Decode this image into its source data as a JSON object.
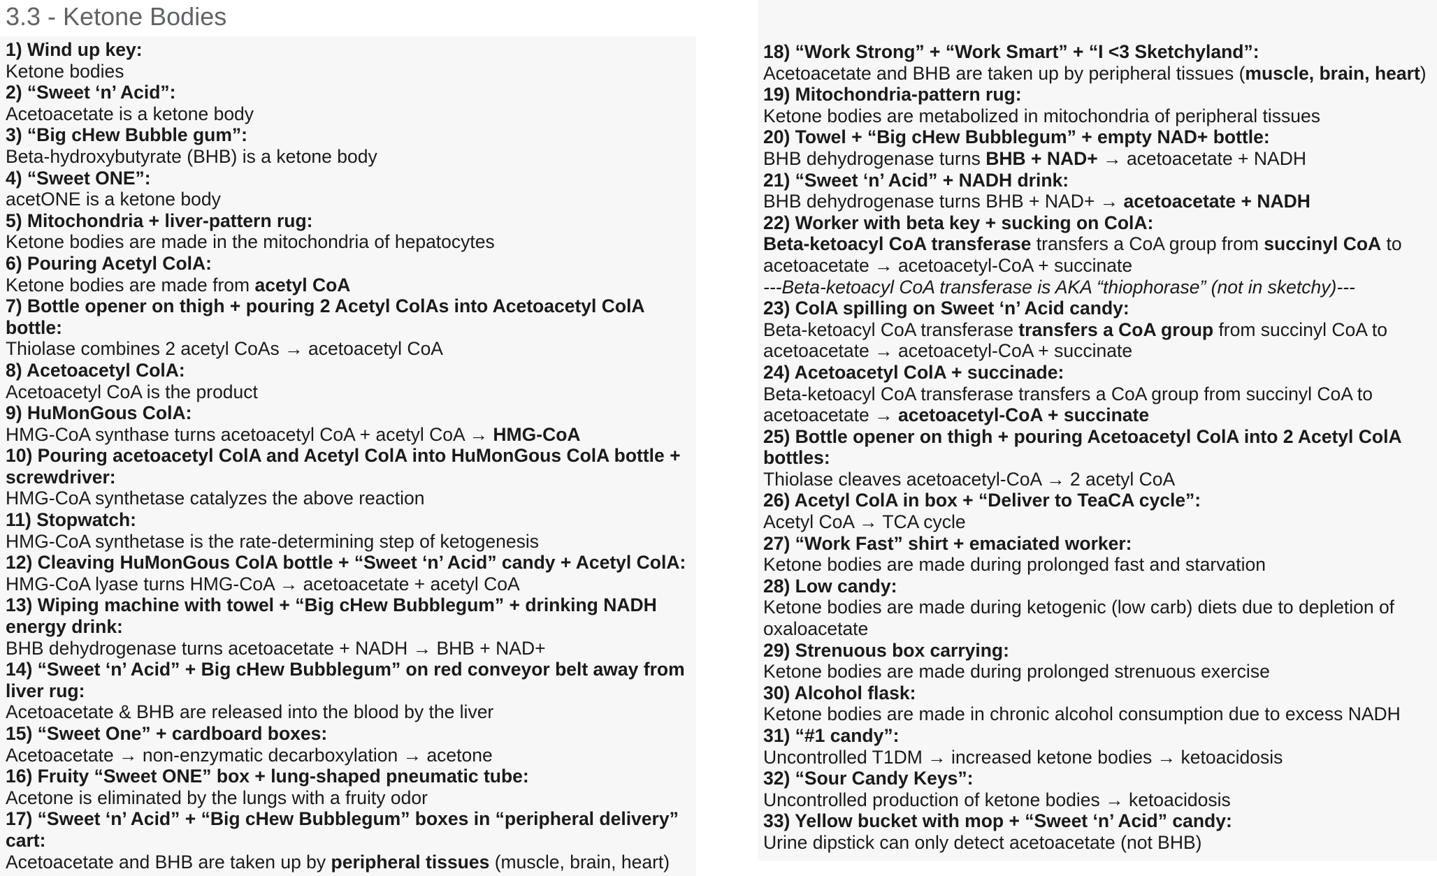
{
  "page": {
    "title": "3.3 - Ketone Bodies"
  },
  "left_column": [
    {
      "heading": "1) Wind up key:",
      "lines": [
        [
          {
            "t": "Ketone bodies"
          }
        ]
      ]
    },
    {
      "heading": "2) “Sweet ‘n’ Acid”:",
      "lines": [
        [
          {
            "t": "Acetoacetate is a ketone body"
          }
        ]
      ]
    },
    {
      "heading": "3) “Big cHew Bubble gum”:",
      "lines": [
        [
          {
            "t": "Beta-hydroxybutyrate (BHB) is a ketone body"
          }
        ]
      ]
    },
    {
      "heading": "4) “Sweet ONE”:",
      "lines": [
        [
          {
            "t": "acetONE is a ketone body"
          }
        ]
      ]
    },
    {
      "heading": "5) Mitochondria + liver-pattern rug:",
      "lines": [
        [
          {
            "t": "Ketone bodies are made in the mitochondria of hepatocytes"
          }
        ]
      ]
    },
    {
      "heading": "6) Pouring Acetyl ColA:",
      "lines": [
        [
          {
            "t": "Ketone bodies are made from "
          },
          {
            "t": "acetyl CoA",
            "b": true
          }
        ]
      ]
    },
    {
      "heading": "7) Bottle opener on thigh + pouring 2 Acetyl ColAs into Acetoacetyl ColA bottle:",
      "lines": [
        [
          {
            "t": "Thiolase combines 2 acetyl CoAs → acetoacetyl CoA"
          }
        ]
      ]
    },
    {
      "heading": "8) Acetoacetyl ColA:",
      "lines": [
        [
          {
            "t": "Acetoacetyl CoA is the product"
          }
        ]
      ]
    },
    {
      "heading": "9) HuMonGous ColA:",
      "lines": [
        [
          {
            "t": "HMG-CoA synthase turns acetoacetyl CoA + acetyl CoA → "
          },
          {
            "t": "HMG-CoA",
            "b": true
          }
        ]
      ]
    },
    {
      "heading": "10) Pouring acetoacetyl ColA and Acetyl ColA into HuMonGous ColA bottle + screwdriver:",
      "lines": [
        [
          {
            "t": "HMG-CoA synthetase catalyzes the above reaction"
          }
        ]
      ]
    },
    {
      "heading": "11) Stopwatch:",
      "lines": [
        [
          {
            "t": "HMG-CoA synthetase is the rate-determining step of ketogenesis"
          }
        ]
      ]
    },
    {
      "heading": "12) Cleaving HuMonGous ColA bottle + “Sweet ‘n’ Acid” candy + Acetyl ColA:",
      "lines": [
        [
          {
            "t": "HMG-CoA lyase turns HMG-CoA → acetoacetate + acetyl CoA"
          }
        ]
      ]
    },
    {
      "heading": "13) Wiping machine with towel + “Big cHew Bubblegum” + drinking NADH energy drink:",
      "lines": [
        [
          {
            "t": "BHB dehydrogenase turns acetoacetate + NADH → BHB + NAD+"
          }
        ]
      ]
    },
    {
      "heading": "14) “Sweet ‘n’ Acid” + Big cHew Bubblegum” on red conveyor belt away from liver rug:",
      "lines": [
        [
          {
            "t": "Acetoacetate & BHB are released into the blood by the liver"
          }
        ]
      ]
    },
    {
      "heading": "15) “Sweet One” + cardboard boxes:",
      "lines": [
        [
          {
            "t": "Acetoacetate → non-enzymatic decarboxylation → acetone"
          }
        ]
      ]
    },
    {
      "heading": "16) Fruity “Sweet ONE” box + lung-shaped pneumatic tube:",
      "lines": [
        [
          {
            "t": "Acetone is eliminated by the lungs with a fruity odor"
          }
        ]
      ]
    },
    {
      "heading": "17) “Sweet ‘n’ Acid” + “Big cHew Bubblegum” boxes in “peripheral delivery” cart:",
      "lines": [
        [
          {
            "t": "Acetoacetate and BHB are taken up by "
          },
          {
            "t": "peripheral tissues",
            "b": true
          },
          {
            "t": " (muscle, brain, heart)"
          }
        ]
      ]
    }
  ],
  "right_column": [
    {
      "heading": "18) “Work Strong” + “Work Smart” + “I <3 Sketchyland”:",
      "lines": [
        [
          {
            "t": "Acetoacetate and BHB are taken up by peripheral tissues ("
          },
          {
            "t": "muscle, brain, heart",
            "b": true
          },
          {
            "t": ")"
          }
        ]
      ]
    },
    {
      "heading": "19) Mitochondria-pattern rug:",
      "lines": [
        [
          {
            "t": "Ketone bodies are metabolized in mitochondria of peripheral tissues"
          }
        ]
      ]
    },
    {
      "heading": "20) Towel + “Big cHew Bubblegum” + empty NAD+ bottle:",
      "lines": [
        [
          {
            "t": "BHB dehydrogenase turns "
          },
          {
            "t": "BHB + NAD+",
            "b": true
          },
          {
            "t": " → acetoacetate + NADH"
          }
        ]
      ]
    },
    {
      "heading": "21) “Sweet ‘n’ Acid” + NADH drink:",
      "lines": [
        [
          {
            "t": "BHB dehydrogenase turns BHB + NAD+ → "
          },
          {
            "t": "acetoacetate + NADH",
            "b": true
          }
        ]
      ]
    },
    {
      "heading": "22) Worker with beta key + sucking on ColA:",
      "lines": [
        [
          {
            "t": "Beta-ketoacyl CoA transferase",
            "b": true
          },
          {
            "t": " transfers a CoA group from "
          },
          {
            "t": "succinyl CoA",
            "b": true
          },
          {
            "t": " to acetoacetate → acetoacetyl-CoA + succinate"
          }
        ],
        [
          {
            "t": "---Beta-ketoacyl CoA transferase is AKA “thiophorase” (not in sketchy)---",
            "i": true
          }
        ]
      ]
    },
    {
      "heading": "23) ColA spilling on Sweet ‘n’ Acid candy:",
      "lines": [
        [
          {
            "t": "Beta-ketoacyl CoA transferase "
          },
          {
            "t": "transfers a CoA group",
            "b": true
          },
          {
            "t": " from succinyl CoA to acetoacetate → acetoacetyl-CoA + succinate"
          }
        ]
      ]
    },
    {
      "heading": "24) Acetoacetyl ColA + succinade:",
      "lines": [
        [
          {
            "t": "Beta-ketoacyl CoA transferase transfers a CoA group from succinyl CoA to acetoacetate → "
          },
          {
            "t": "acetoacetyl-CoA + succinate",
            "b": true
          }
        ]
      ]
    },
    {
      "heading": "25) Bottle opener on thigh + pouring Acetoacetyl ColA into 2 Acetyl ColA bottles:",
      "lines": [
        [
          {
            "t": "Thiolase cleaves acetoacetyl-CoA → 2 acetyl CoA"
          }
        ]
      ]
    },
    {
      "heading": "26) Acetyl ColA in box + “Deliver to TeaCA cycle”:",
      "lines": [
        [
          {
            "t": "Acetyl CoA → TCA cycle"
          }
        ]
      ]
    },
    {
      "heading": "27) “Work Fast” shirt + emaciated worker:",
      "lines": [
        [
          {
            "t": "Ketone bodies are made during prolonged fast and starvation"
          }
        ]
      ]
    },
    {
      "heading": "28) Low candy:",
      "lines": [
        [
          {
            "t": "Ketone bodies are made during ketogenic (low carb) diets due to depletion of oxaloacetate"
          }
        ]
      ]
    },
    {
      "heading": "29) Strenuous box carrying:",
      "lines": [
        [
          {
            "t": "Ketone bodies are made during prolonged strenuous exercise"
          }
        ]
      ]
    },
    {
      "heading": "30) Alcohol flask:",
      "lines": [
        [
          {
            "t": "Ketone bodies are made in chronic alcohol consumption due to excess NADH"
          }
        ]
      ]
    },
    {
      "heading": "31) “#1 candy”:",
      "lines": [
        [
          {
            "t": "Uncontrolled T1DM → increased ketone bodies → ketoacidosis"
          }
        ]
      ]
    },
    {
      "heading": "32) “Sour Candy Keys”:",
      "lines": [
        [
          {
            "t": "Uncontrolled production of ketone bodies → ketoacidosis"
          }
        ]
      ]
    },
    {
      "heading": "33) Yellow bucket with mop + “Sweet ‘n’ Acid” candy:",
      "lines": [
        [
          {
            "t": "Urine dipstick can only detect acetoacetate (not BHB)"
          }
        ]
      ]
    }
  ]
}
